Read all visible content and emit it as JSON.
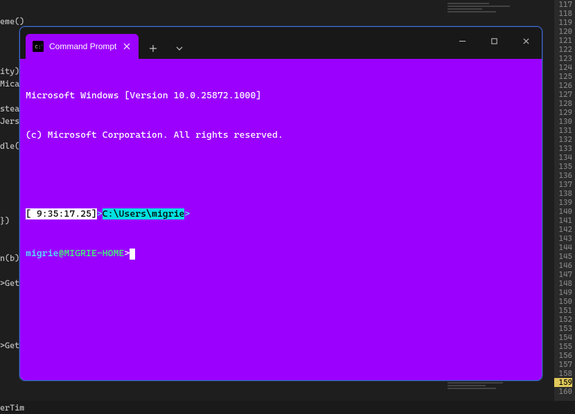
{
  "background": {
    "left_fragments": [
      "",
      "eme());",
      "",
      "",
      "",
      "ity)",
      "Mica(",
      "",
      "stead",
      "Jers",
      "",
      "dle(",
      "",
      "",
      "",
      "",
      "",
      "})",
      "",
      "",
      "n(b);",
      "",
      ">GetH",
      "",
      "",
      "",
      "",
      ">GetH",
      "",
      "",
      "",
      "",
      "erTimer();"
    ],
    "line_numbers_start": 117,
    "line_numbers_end": 160,
    "highlight_line": 159
  },
  "tab": {
    "title": "Command Prompt"
  },
  "terminal": {
    "banner_line1": "Microsoft Windows [Version 10.0.25872.1000]",
    "banner_line2": "(c) Microsoft Corporation. All rights reserved.",
    "time_prompt": "[ 9:35:17.25]",
    "gt1": ">",
    "cwd": "C:\\Users\\migrie",
    "gt2": ">",
    "user": "migrie",
    "at": "@",
    "host": "MIGRIE-HOME",
    "gt3": ">"
  }
}
